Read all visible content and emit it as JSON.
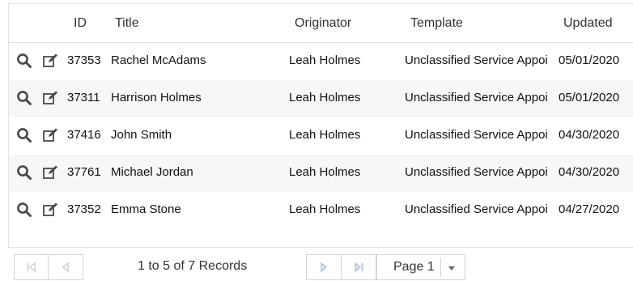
{
  "columns": {
    "id": "ID",
    "title": "Title",
    "originator": "Originator",
    "template": "Template",
    "updated": "Updated"
  },
  "rows": [
    {
      "id": "37353",
      "title": "Rachel McAdams",
      "originator": "Leah Holmes",
      "template": "Unclassified Service Appoi",
      "updated": "05/01/2020"
    },
    {
      "id": "37311",
      "title": "Harrison Holmes",
      "originator": "Leah Holmes",
      "template": "Unclassified Service Appoi",
      "updated": "05/01/2020"
    },
    {
      "id": "37416",
      "title": "John Smith",
      "originator": "Leah Holmes",
      "template": "Unclassified Service Appoi",
      "updated": "04/30/2020"
    },
    {
      "id": "37761",
      "title": "Michael Jordan",
      "originator": "Leah Holmes",
      "template": "Unclassified Service Appoi",
      "updated": "04/30/2020"
    },
    {
      "id": "37352",
      "title": "Emma Stone",
      "originator": "Leah Holmes",
      "template": "Unclassified Service Appoi",
      "updated": "04/27/2020"
    }
  ],
  "pager": {
    "records_text": "1 to 5 of 7 Records",
    "page_label": "Page 1"
  },
  "colors": {
    "icon": "#4a4a4a",
    "pager_icon": "#a9bfd8",
    "pager_icon_disabled": "#c8c8c8",
    "row_alt": "#f7f7f7"
  }
}
